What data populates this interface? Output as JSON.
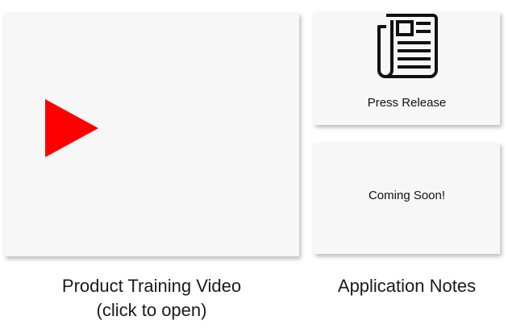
{
  "video_card": {
    "icon": "play-icon",
    "play_color": "#ff0000",
    "caption_line1": "Product Training Video",
    "caption_line2": "(click to open)"
  },
  "press_card": {
    "icon": "newspaper-icon",
    "label": "Press Release"
  },
  "notes_card": {
    "label": "Coming Soon!",
    "caption": "Application Notes"
  }
}
